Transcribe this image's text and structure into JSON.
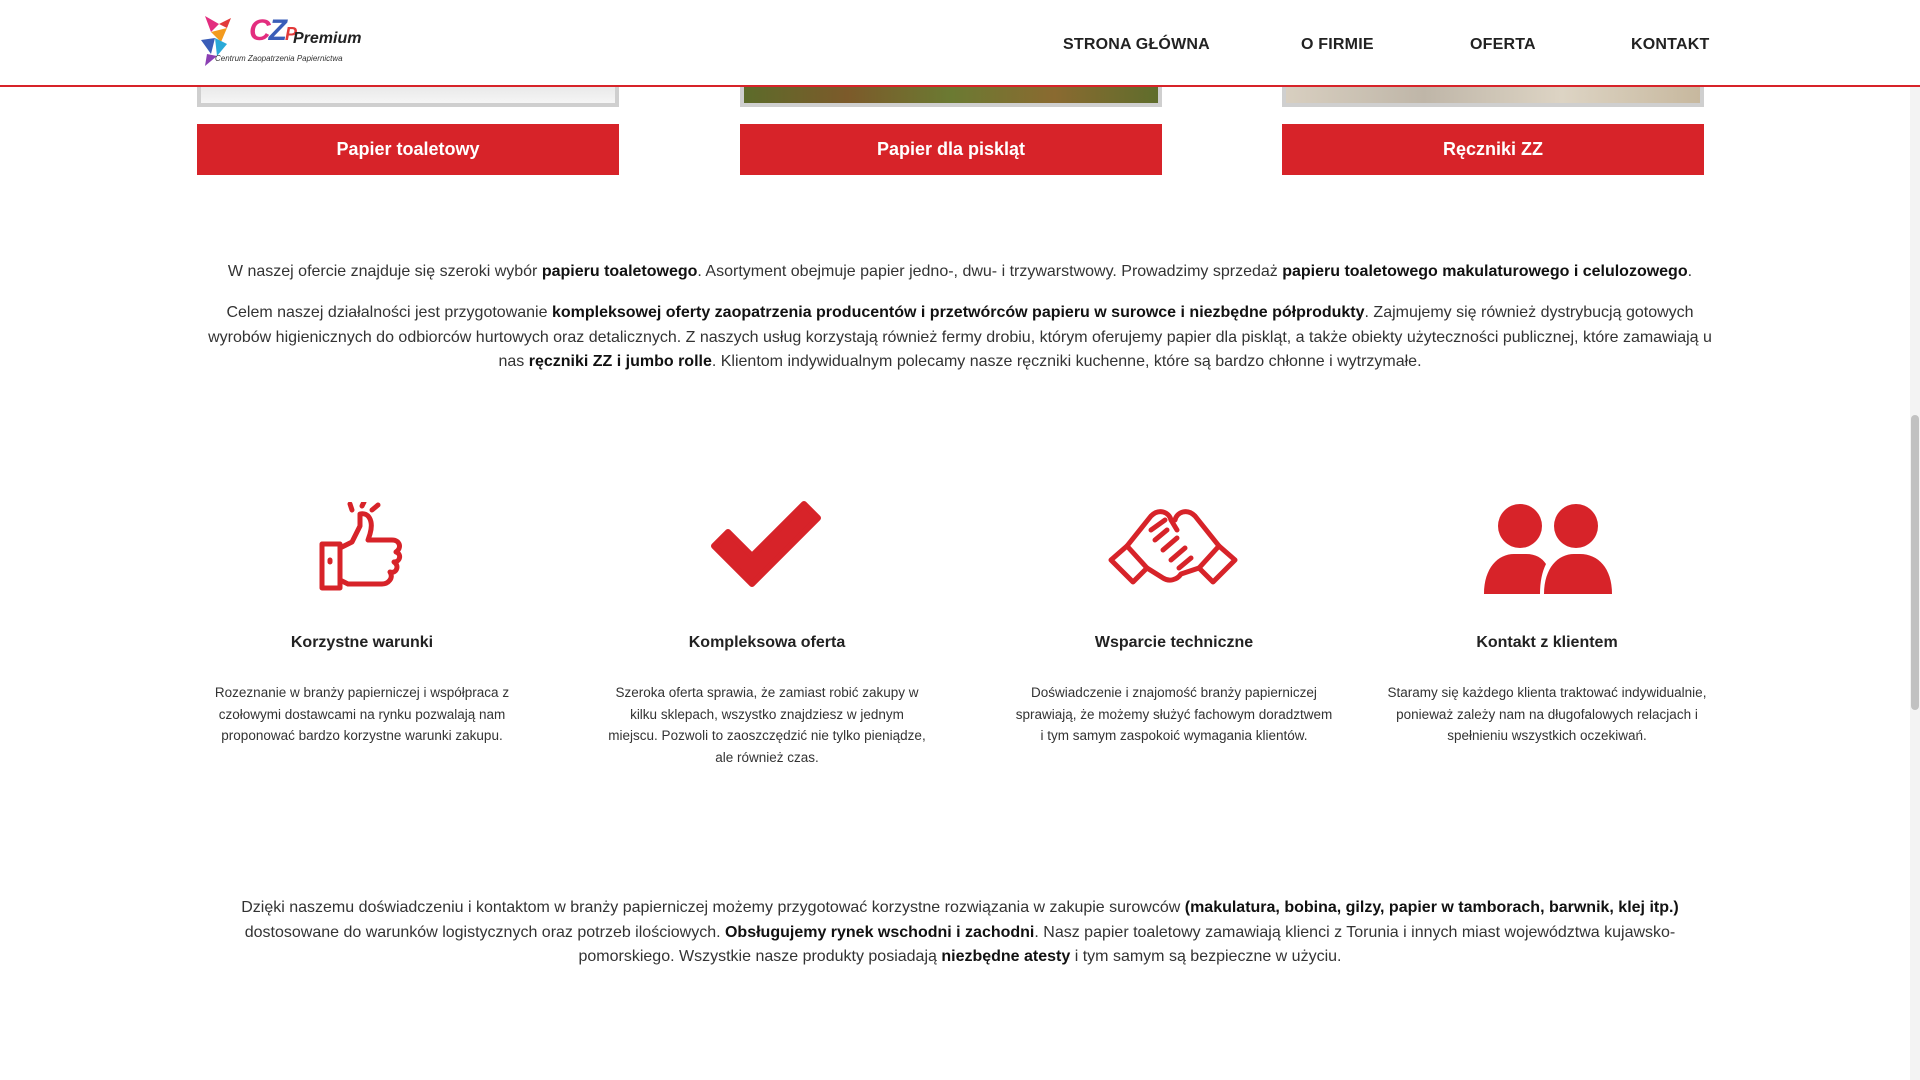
{
  "logo": {
    "name": "CZP Premium",
    "main_c": "C",
    "main_z": "Z",
    "main_p": "P",
    "premium": "Premium",
    "subtitle": "Centrum Zaopatrzenia Papiernictwa"
  },
  "nav": [
    {
      "label": "STRONA GŁÓWNA"
    },
    {
      "label": "O FIRMIE"
    },
    {
      "label": "OFERTA"
    },
    {
      "label": "KONTAKT"
    }
  ],
  "products": [
    {
      "label": "Papier toaletowy"
    },
    {
      "label": "Papier dla piskląt"
    },
    {
      "label": "Ręczniki ZZ"
    }
  ],
  "intro": {
    "p1": {
      "t1": "W naszej ofercie znajduje się szeroki wybór ",
      "b1": "papieru toaletowego",
      "t2": ". Asortyment obejmuje papier jedno-, dwu- i trzywarstwowy. Prowadzimy sprzedaż ",
      "b2": "papieru toaletowego makulaturowego i celulozowego",
      "t3": "."
    },
    "p2": {
      "t1": "Celem naszej działalności jest przygotowanie ",
      "b1": "kompleksowej oferty zaopatrzenia producentów i przetwórców papieru w surowce i niezbędne półprodukty",
      "t2": ". Zajmujemy się również dystrybucją gotowych wyrobów higienicznych do odbiorców hurtowych oraz detalicznych. Z naszych usług korzystają również fermy drobiu, którym oferujemy papier dla piskląt, a także obiekty użyteczności publicznej, które zamawiają u nas ",
      "b2": "ręczniki ZZ i jumbo rolle",
      "t3": ". Klientom indywidualnym polecamy nasze ręczniki kuchenne, które są bardzo chłonne i wytrzymałe."
    }
  },
  "features": [
    {
      "icon": "thumbs-up-icon",
      "title": "Korzystne warunki",
      "desc": "Rozeznanie w branży papierniczej i współpraca z czołowymi dostawcami na rynku pozwalają nam proponować bardzo korzystne warunki zakupu."
    },
    {
      "icon": "checkmark-icon",
      "title": "Kompleksowa oferta",
      "desc": "Szeroka oferta sprawia, że zamiast robić zakupy w kilku sklepach, wszystko znajdziesz w jednym miejscu. Pozwoli to zaoszczędzić nie tylko pieniądze, ale również czas."
    },
    {
      "icon": "handshake-icon",
      "title": "Wsparcie techniczne",
      "desc": "Doświadczenie i znajomość branży papierniczej sprawiają, że możemy służyć fachowym doradztwem i tym samym zaspokoić wymagania klientów."
    },
    {
      "icon": "users-icon",
      "title": "Kontakt z klientem",
      "desc": "Staramy się każdego klienta traktować indywidualnie, ponieważ zależy nam na długofalowych relacjach i spełnieniu wszystkich oczekiwań."
    }
  ],
  "outro": {
    "t1": "Dzięki naszemu doświadczeniu i kontaktom w branży papierniczej możemy przygotować korzystne rozwiązania w zakupie surowców ",
    "b1": "(makulatura, bobina, gilzy, papier w tamborach, barwnik, klej itp.)",
    "t2": " dostosowane do warunków logistycznych oraz potrzeb ilościowych. ",
    "b2": "Obsługujemy rynek wschodni i zachodni",
    "t3": ". Nasz papier toaletowy zamawiają klienci z Torunia i innych miast województwa kujawsko-pomorskiego. Wszystkie nasze produkty posiadają ",
    "b3": "niezbędne atesty",
    "t4": " i tym samym są bezpieczne w użyciu."
  },
  "colors": {
    "accent": "#d72329",
    "text": "#333333"
  }
}
